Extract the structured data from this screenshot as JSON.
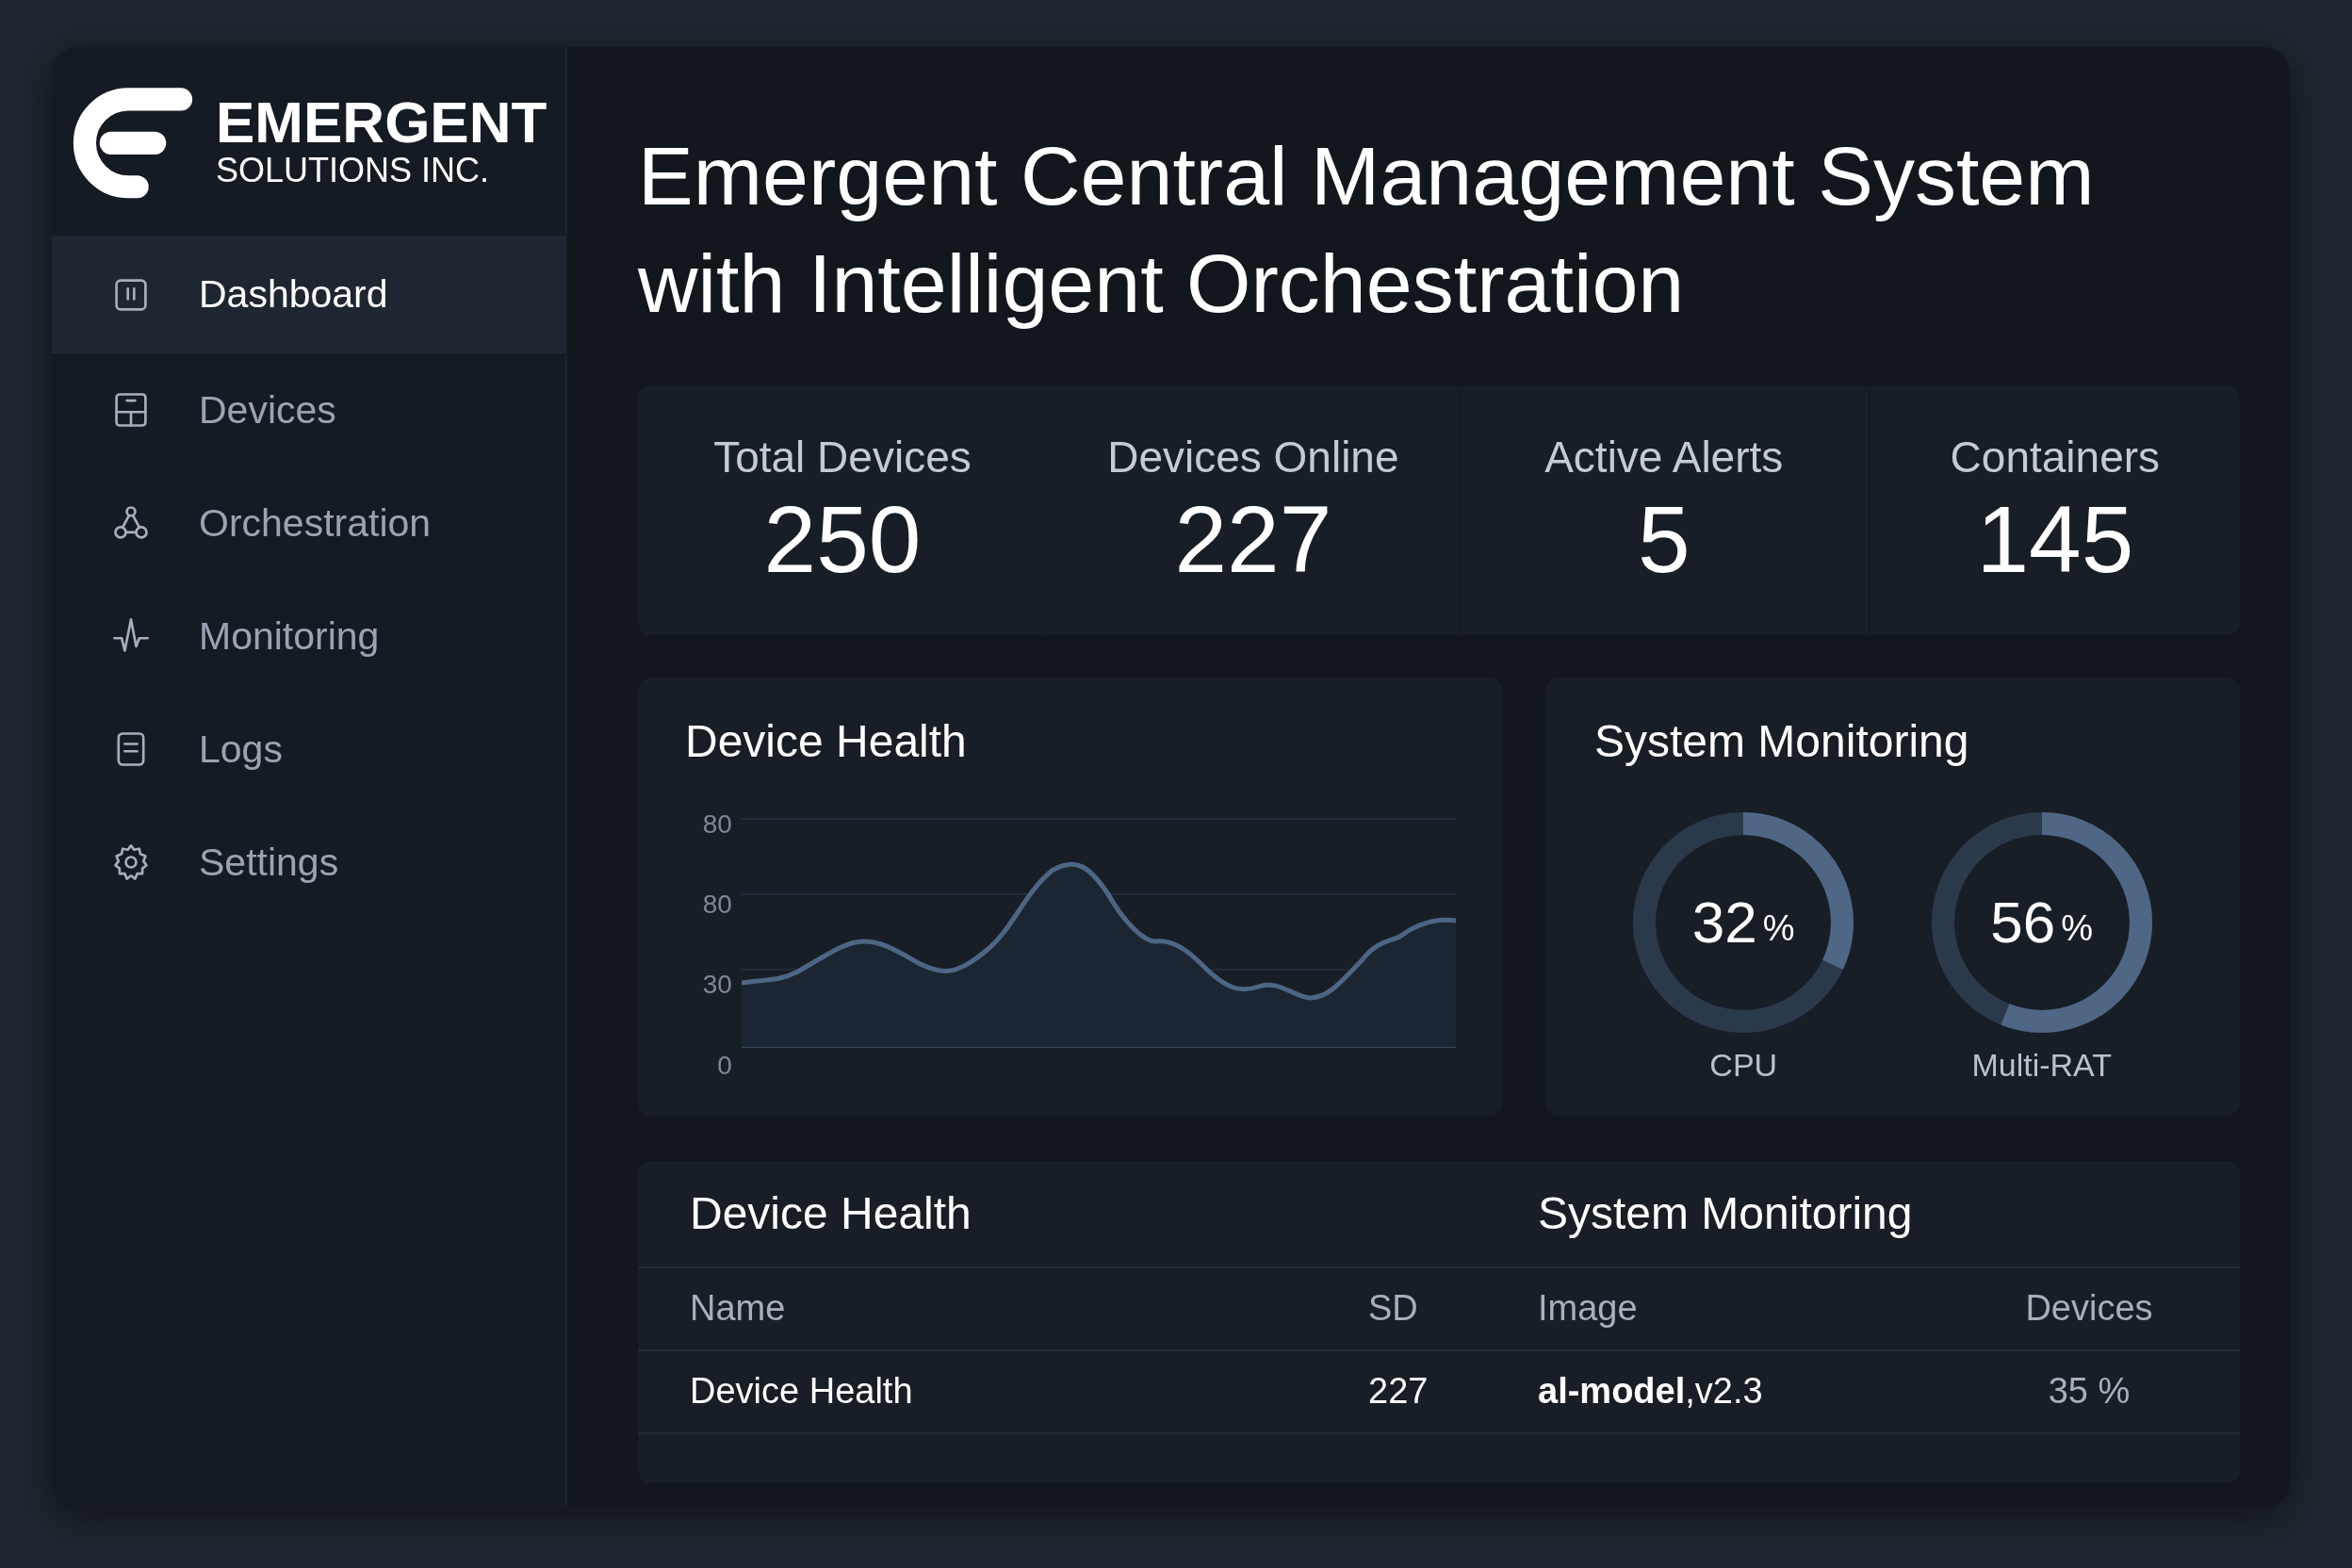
{
  "brand": {
    "name": "EMERGENT",
    "subtitle": "SOLUTIONS INC."
  },
  "sidebar": {
    "items": [
      {
        "label": "Dashboard",
        "kind": "dashboard",
        "selected": true
      },
      {
        "label": "Devices",
        "kind": "devices",
        "selected": false
      },
      {
        "label": "Orchestration",
        "kind": "orchestration",
        "selected": false
      },
      {
        "label": "Monitoring",
        "kind": "monitoring",
        "selected": false
      },
      {
        "label": "Logs",
        "kind": "logs",
        "selected": false
      },
      {
        "label": "Settings",
        "kind": "settings",
        "selected": false
      }
    ]
  },
  "title": "Emergent Central Management System with Intelligent Orchestration",
  "stats": [
    {
      "label": "Total Devices",
      "value": "250"
    },
    {
      "label": "Devices Online",
      "value": "227"
    },
    {
      "label": "Active Alerts",
      "value": "5"
    },
    {
      "label": "Containers",
      "value": "145"
    }
  ],
  "device_health_chart": {
    "title": "Device Health",
    "y_axis_labels": [
      "80",
      "80",
      "30",
      "0"
    ]
  },
  "system_monitoring": {
    "title": "System Monitoring",
    "gauges": [
      {
        "label": "CPU",
        "value": "32",
        "unit": "%",
        "level": 0.32
      },
      {
        "label": "Multi-RAT",
        "value": "56",
        "unit": "%",
        "level": 0.56
      }
    ]
  },
  "table": {
    "section_titles": [
      "Device Health",
      "System Monitoring"
    ],
    "columns": [
      "Name",
      "SD",
      "Image",
      "Devices"
    ],
    "rows": [
      [
        "Device Health",
        "227",
        "**al-model**,v2.3",
        "35 %"
      ]
    ]
  }
}
